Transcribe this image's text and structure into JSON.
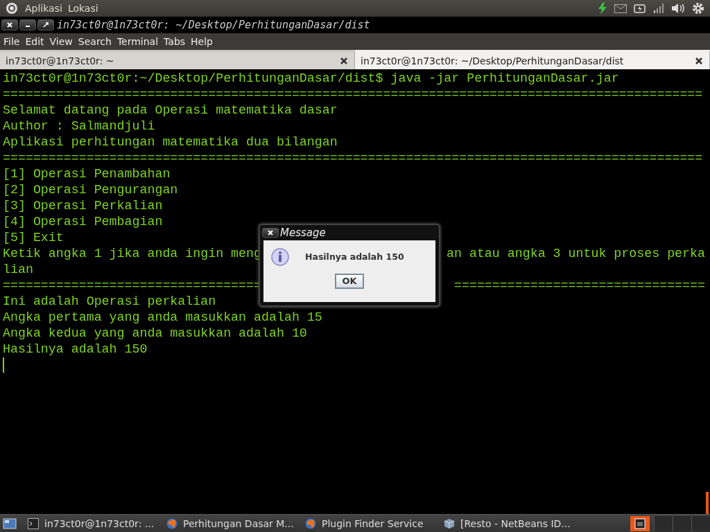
{
  "top_panel": {
    "menus": [
      "Aplikasi",
      "Lokasi"
    ]
  },
  "window": {
    "title": "in73ct0r@1n73ct0r: ~/Desktop/PerhitunganDasar/dist"
  },
  "menu_bar": [
    "File",
    "Edit",
    "View",
    "Search",
    "Terminal",
    "Tabs",
    "Help"
  ],
  "tabs": [
    {
      "label": "in73ct0r@1n73ct0r: ~",
      "selected": false
    },
    {
      "label": "in73ct0r@1n73ct0r: ~/Desktop/PerhitunganDasar/dist",
      "selected": true
    }
  ],
  "terminal": {
    "lines": [
      {
        "kind": "text",
        "text": "in73ct0r@1n73ct0r:~/Desktop/PerhitunganDasar/dist$ java -jar PerhitunganDasar.jar"
      },
      {
        "kind": "text",
        "text": "============================================================================================"
      },
      {
        "kind": "text",
        "text": "Selamat datang pada Operasi matematika dasar"
      },
      {
        "kind": "text",
        "text": "Author : Salmandjuli"
      },
      {
        "kind": "text",
        "text": "Aplikasi perhitungan matematika dua bilangan"
      },
      {
        "kind": "text",
        "text": "============================================================================================"
      },
      {
        "kind": "text",
        "text": "[1] Operasi Penambahan"
      },
      {
        "kind": "text",
        "text": "[2] Operasi Pengurangan"
      },
      {
        "kind": "text",
        "text": "[3] Operasi Perkalian"
      },
      {
        "kind": "text",
        "text": "[4] Operasi Pembagian"
      },
      {
        "kind": "text",
        "text": "[5] Exit"
      },
      {
        "kind": "split",
        "left": "Ketik angka 1 jika anda ingin meng",
        "right": "an atau angka 3 untuk proses perka"
      },
      {
        "kind": "text",
        "text": "lian"
      },
      {
        "kind": "split",
        "left": "==================================",
        "right": "================================="
      },
      {
        "kind": "text",
        "text": "Ini adalah Operasi perkalian"
      },
      {
        "kind": "text",
        "text": "Angka pertama yang anda masukkan adalah 15"
      },
      {
        "kind": "text",
        "text": "Angka kedua yang anda masukkan adalah 10"
      },
      {
        "kind": "text",
        "text": "Hasilnya adalah 150"
      }
    ]
  },
  "dialog": {
    "title": "Message",
    "message": "Hasilnya adalah 150",
    "button": "OK"
  },
  "taskbar": {
    "items": [
      {
        "label": "in73ct0r@1n73ct0r: ...",
        "kind": "terminal"
      },
      {
        "label": "Perhitungan Dasar M...",
        "kind": "browser"
      },
      {
        "label": "Plugin Finder Service",
        "kind": "browser"
      },
      {
        "label": "[Resto - NetBeans ID...",
        "kind": "cube"
      }
    ]
  }
}
